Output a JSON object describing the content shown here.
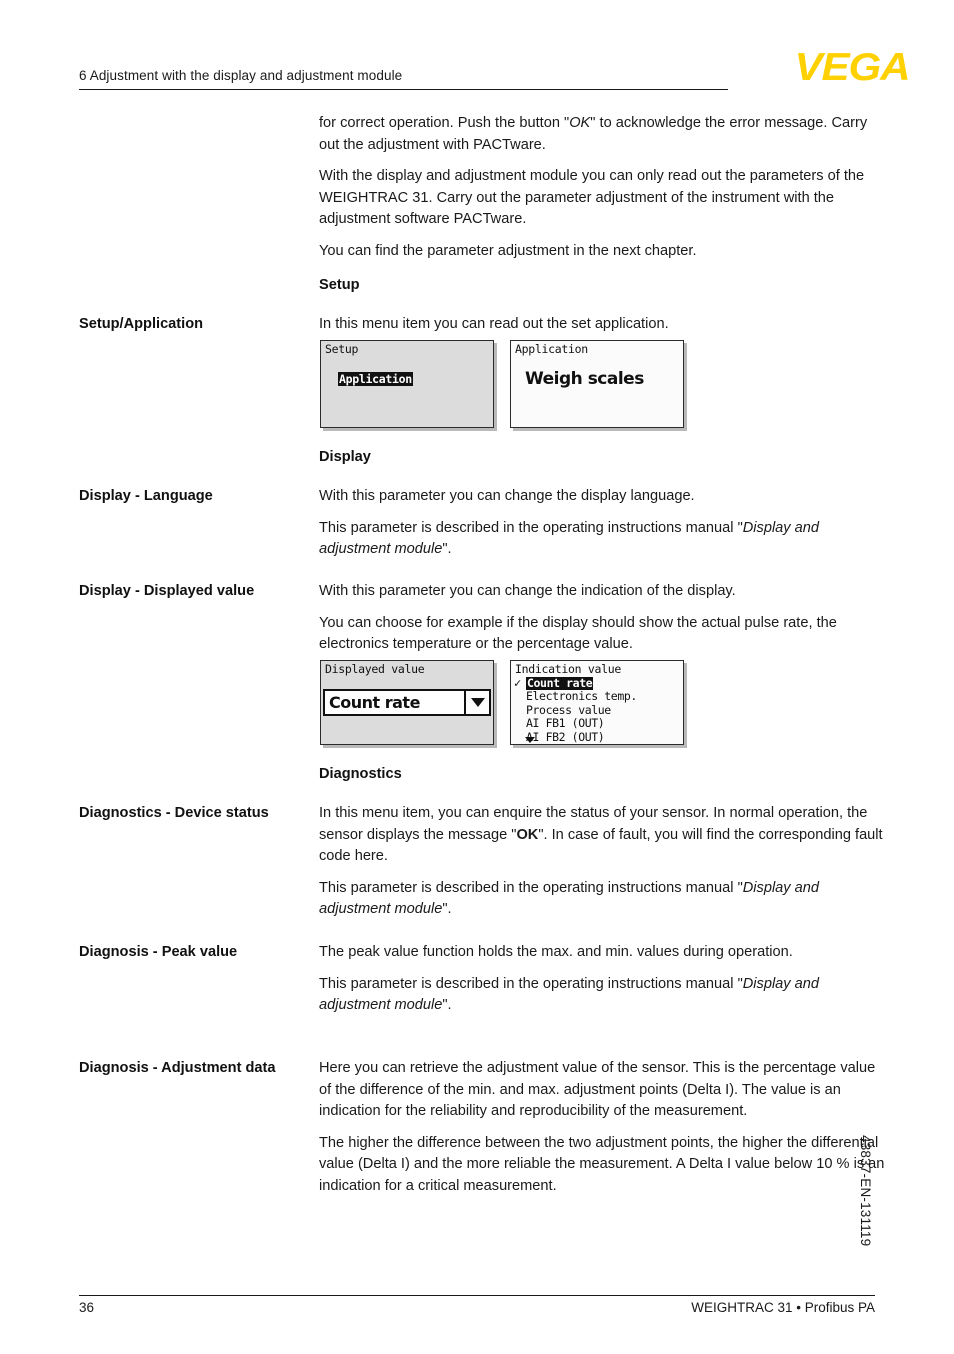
{
  "header": {
    "chapter_title": "6 Adjustment with the display and adjustment module",
    "logo_text": "VEGA"
  },
  "intro": {
    "p1_a": "for correct operation. Push the button \"",
    "p1_ok": "OK",
    "p1_b": "\" to acknowledge the error message. Carry out the adjustment with PACTware.",
    "p2": "With the display and adjustment module you can only read out the parameters of the WEIGHTRAC 31. Carry out the parameter adjustment of the instrument with the adjustment software PACTware.",
    "p3": "You can find the parameter adjustment in the next chapter."
  },
  "setup": {
    "heading": "Setup",
    "margin_label": "Setup/Application",
    "p1": "In this menu item you can read out the set application.",
    "lcd_left": {
      "title": "Setup",
      "selected_item": "Application"
    },
    "lcd_right": {
      "title": "Application",
      "value": "Weigh scales"
    }
  },
  "display": {
    "heading": "Display",
    "language": {
      "margin_label": "Display - Language",
      "p1": "With this parameter you can change the display language.",
      "p2_a": "This parameter is described in the operating instructions manual \"",
      "p2_em": "Display and adjustment module",
      "p2_b": "\"."
    },
    "displayed_value": {
      "margin_label": "Display - Displayed value",
      "p1": "With this parameter you can change the indication of the display.",
      "p2": "You can choose for example if the display should show the actual pulse rate, the electronics temperature or the percentage value.",
      "lcd_left": {
        "title": "Displayed value",
        "combo_value": "Count rate",
        "combo_arrow": "chevron-down"
      },
      "lcd_right": {
        "title": "Indication value",
        "items": [
          {
            "label": "Count rate",
            "checked": true,
            "selected": true
          },
          {
            "label": "Electronics temp.",
            "checked": false,
            "selected": false
          },
          {
            "label": "Process value",
            "checked": false,
            "selected": false
          },
          {
            "label": "AI FB1 (OUT)",
            "checked": false,
            "selected": false
          },
          {
            "label": "AI FB2 (OUT)",
            "checked": false,
            "selected": false
          }
        ],
        "scroll_more": "more-below"
      }
    }
  },
  "diagnostics": {
    "heading": "Diagnostics",
    "device_status": {
      "margin_label": "Diagnostics - Device status",
      "p1_a": "In this menu item, you can enquire the status of your sensor. In normal operation, the sensor displays the message \"",
      "p1_ok": "OK",
      "p1_b": "\". In case of fault, you will find the corresponding fault code here.",
      "p2_a": "This parameter is described in the operating instructions manual \"",
      "p2_em": "Display and adjustment module",
      "p2_b": "\"."
    },
    "peak_value": {
      "margin_label": "Diagnosis - Peak value",
      "p1": "The peak value function holds the max. and min. values during operation.",
      "p2_a": "This parameter is described in the operating instructions manual \"",
      "p2_em": "Display and adjustment module",
      "p2_b": "\"."
    },
    "adjustment_data": {
      "margin_label": "Diagnosis - Adjustment data",
      "p1": "Here you can retrieve the adjustment value of the sensor. This is the percentage value of the difference of the min. and max. adjustment points (Delta I). The value is an indication for the reliability and reproducibility of the measurement.",
      "p2": "The higher the difference between the two adjustment points, the higher the differential value (Delta I) and the more reliable the measurement. A Delta I value below 10 % is an indication for a critical measurement."
    }
  },
  "footer": {
    "page_number": "36",
    "document_title": "WEIGHTRAC 31 • Profibus PA",
    "side_code": "43837-EN-131119"
  },
  "colors": {
    "brand_yellow": "#ffd100",
    "text": "#1a1a1a",
    "lcd_gray": "#dcdcdc"
  }
}
